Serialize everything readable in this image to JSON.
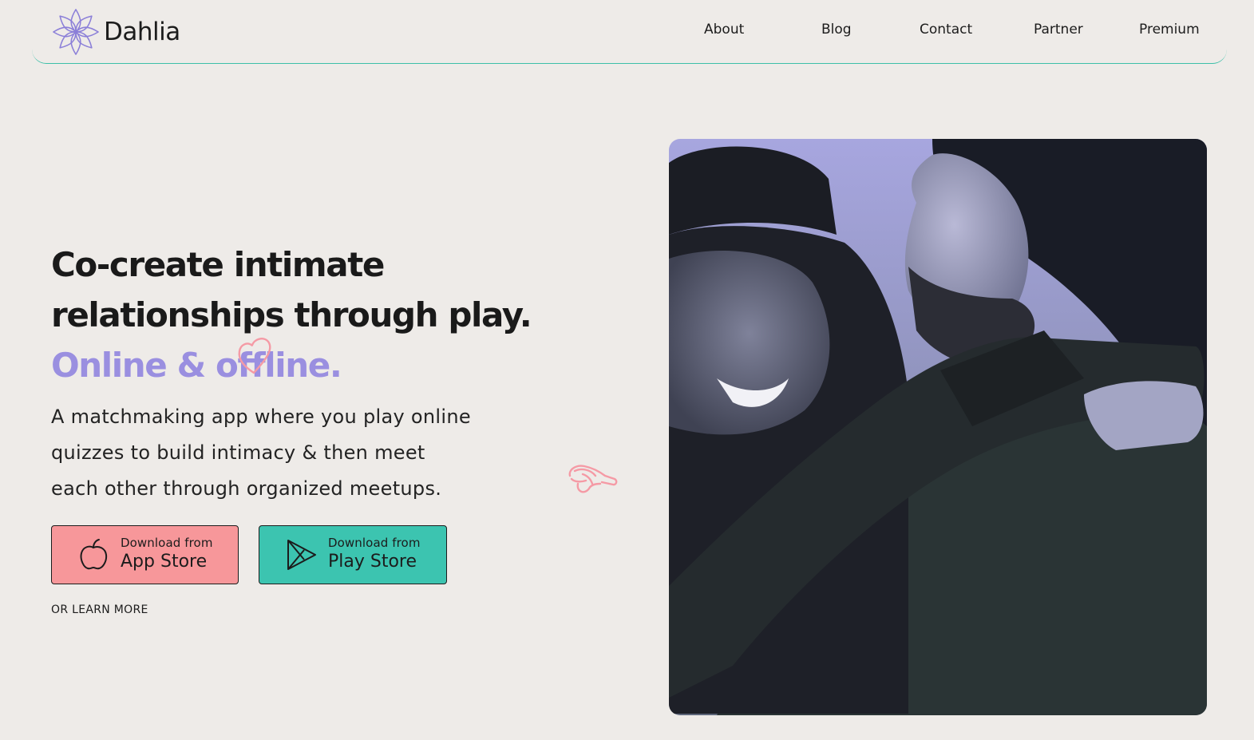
{
  "brand": {
    "name": "Dahlia",
    "logo_icon": "dahlia-flower-icon",
    "accent_color": "#9a8fe0"
  },
  "nav": {
    "items": [
      {
        "label": "About"
      },
      {
        "label": "Blog"
      },
      {
        "label": "Contact"
      },
      {
        "label": "Partner"
      },
      {
        "label": "Premium"
      }
    ]
  },
  "hero": {
    "title_lines": [
      "Co-create intimate",
      "relationships through play."
    ],
    "title_accent": "Online & offline.",
    "description_lines": [
      "A matchmaking app where you play online",
      "quizzes to build intimacy & then meet",
      "each other through organized meetups."
    ],
    "buttons": {
      "app_store": {
        "small": "Download from",
        "big": "App Store",
        "icon": "apple-icon",
        "color": "#f7979a"
      },
      "play_store": {
        "small": "Download from",
        "big": "Play Store",
        "icon": "play-store-icon",
        "color": "#3cc4b0"
      }
    },
    "learn_more": "OR LEARN MORE",
    "doodles": [
      "heart-doodle",
      "pointing-hand-doodle"
    ]
  },
  "colors": {
    "background": "#eeebe8",
    "header_rule": "#3dbfa8",
    "doodle": "#f59aa5"
  }
}
